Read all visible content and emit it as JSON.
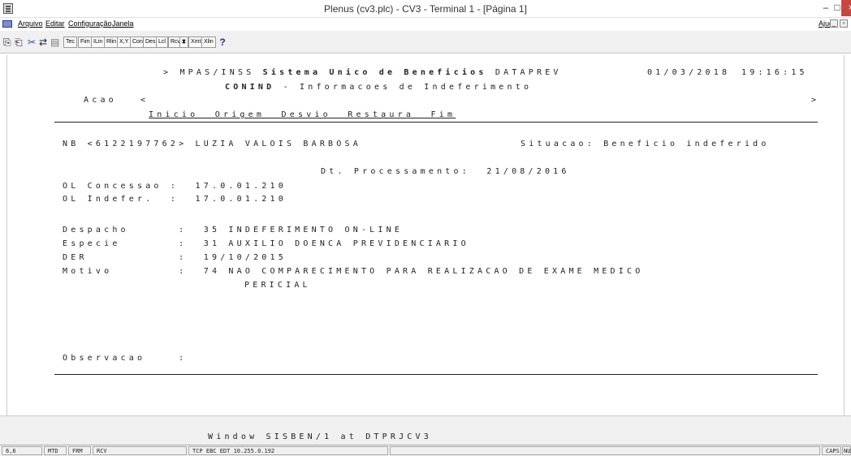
{
  "window": {
    "title": "Plenus (cv3.plc) - CV3 - Terminal 1 - [Página 1]",
    "minimize": "–",
    "maximize": "□",
    "close": "×"
  },
  "menu": {
    "items": [
      "Arquivo",
      "Editar",
      "Configuração",
      "Janela"
    ],
    "help": "Ajuda",
    "mdi_min": "_",
    "mdi_restore": "▫"
  },
  "toolbar": {
    "buttons": [
      "Tec",
      "Fim",
      "ILin",
      "Rlin",
      "X,Y",
      "Con",
      "Des",
      "Lcl",
      "Rcv",
      "⧗",
      "Xmt",
      "Xlin"
    ],
    "help": "?"
  },
  "screen": {
    "header_prefix": "> MPAS/INSS",
    "header_bold": "Sistema Unico de Beneficios",
    "header_suffix": "DATAPREV",
    "date": "01/03/2018",
    "time": "19:16:15",
    "sub_bold": "CONIND",
    "sub_title": "- Informacoes de Indeferimento",
    "acao_label": "Acao",
    "acao_left": "<",
    "acao_right": ">",
    "menu_options": "Inicio  Origem  Desvio  Restaura  Fim",
    "nb_line": "NB <6122197762> LUZIA VALOIS BARBOSA",
    "situacao": "Situacao: Beneficio indeferido",
    "dt_processamento": "Dt. Processamento:  21/08/2016",
    "ol_concessao": "OL Concessao :  17.0.01.210",
    "ol_indefer": "OL Indefer.  :  17.0.01.210",
    "despacho": "Despacho      :  35 INDEFERIMENTO ON-LINE",
    "especie": "Especie       :  31 AUXILIO DOENCA PREVIDENCIARIO",
    "der": "DER           :  19/10/2015",
    "motivo": "Motivo        :  74 NAO COMPARECIMENTO PARA REALIZACAO DE EXAME MEDICO",
    "motivo_cont": "PERICIAL",
    "observacao": "Observacao    :"
  },
  "footer": {
    "window_line": "Window SISBEN/1 at DTPRJCV3"
  },
  "statusbar": {
    "cursor": "6,6",
    "mtd": "MTD",
    "frm": "FRM",
    "rcv": "RCV",
    "connection": "TCP EBC EDT 10.255.0.192",
    "caps": "CAPS",
    "num": "NU"
  }
}
